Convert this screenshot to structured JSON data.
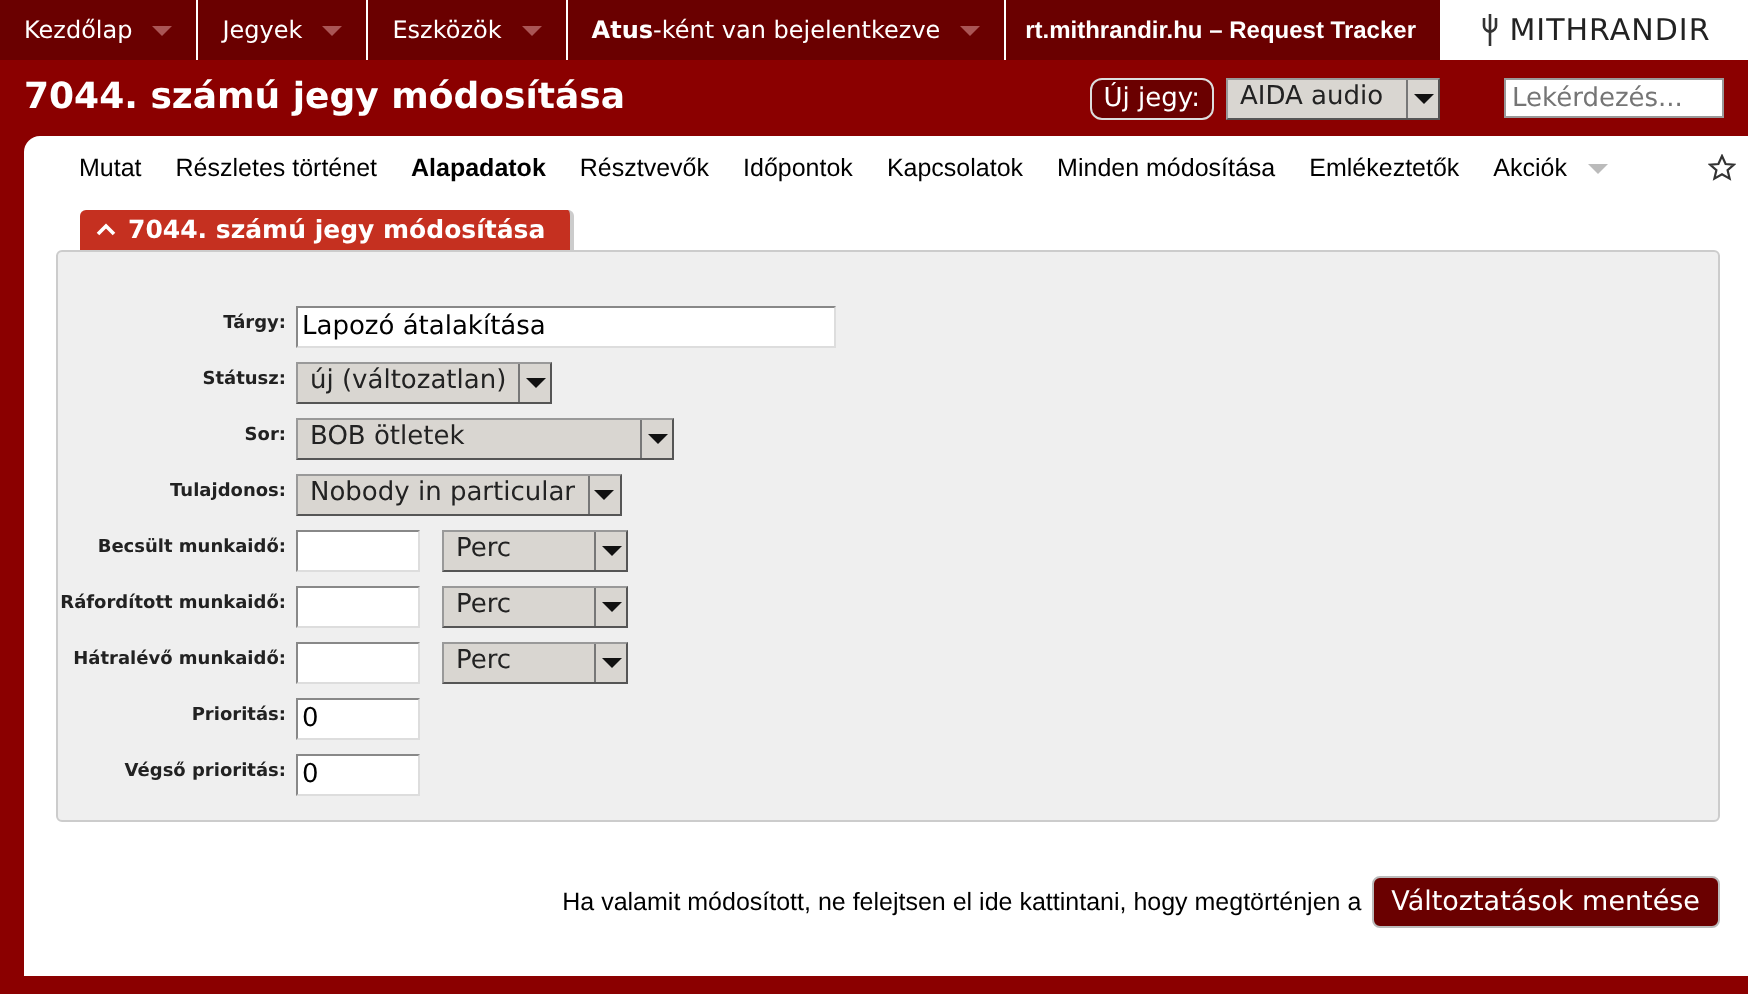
{
  "top_menu": [
    {
      "label": "Kezdőlap",
      "has_caret": true
    },
    {
      "label": "Jegyek",
      "has_caret": true
    },
    {
      "label": "Eszközök",
      "has_caret": true
    },
    {
      "label": "**Atus**-ként van bejelentkezve",
      "has_caret": true
    }
  ],
  "site_title": "rt.mithrandir.hu – Request Tracker",
  "logo_text": "MITHRANDIR",
  "page_title": "7044. számú jegy módosítása",
  "new_ticket": {
    "label": "Új jegy:",
    "queue": "AIDA audio"
  },
  "search": {
    "placeholder": "Lekérdezés..."
  },
  "tabs": [
    {
      "label": "Mutat",
      "selected": false
    },
    {
      "label": "Részletes történet",
      "selected": false
    },
    {
      "label": "Alapadatok",
      "selected": true
    },
    {
      "label": "Résztvevők",
      "selected": false
    },
    {
      "label": "Időpontok",
      "selected": false
    },
    {
      "label": "Kapcsolatok",
      "selected": false
    },
    {
      "label": "Minden módosítása",
      "selected": false
    },
    {
      "label": "Emlékeztetők",
      "selected": false
    },
    {
      "label": "Akciók",
      "selected": false,
      "has_caret": true
    }
  ],
  "panel": {
    "title": "7044. számú jegy módosítása",
    "expanded": true,
    "fields": [
      {
        "label": "Tárgy:",
        "kind": "text",
        "value": "Lapozó átalakítása"
      },
      {
        "label": "Státusz:",
        "kind": "select",
        "value": "új (változatlan)"
      },
      {
        "label": "Sor:",
        "kind": "select",
        "value": "BOB ötletek",
        "wide": true
      },
      {
        "label": "Tulajdonos:",
        "kind": "select",
        "value": "Nobody in particular"
      },
      {
        "label": "Becsült munkaidő:",
        "kind": "duration",
        "unit": "Perc"
      },
      {
        "label": "Ráfordított munkaidő:",
        "kind": "duration",
        "unit": "Perc"
      },
      {
        "label": "Hátralévő munkaidő:",
        "kind": "duration",
        "unit": "Perc"
      },
      {
        "label": "Prioritás:",
        "kind": "number",
        "value": "0"
      },
      {
        "label": "Végső prioritás:",
        "kind": "number",
        "value": "0"
      }
    ]
  },
  "footer": {
    "hint": "Ha valamit módosított, ne felejtsen el ide kattintani, hogy megtörténjen a",
    "button": "Változtatások mentése"
  }
}
